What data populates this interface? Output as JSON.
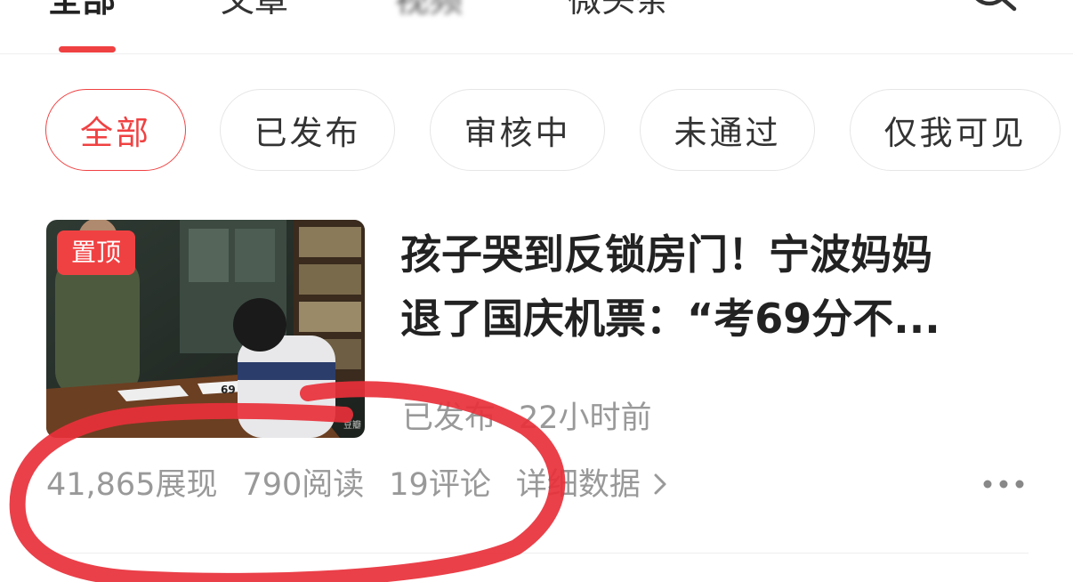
{
  "top_tabs": [
    {
      "label": "全部",
      "active": true
    },
    {
      "label": "文章",
      "active": false
    },
    {
      "label": "视频",
      "active": false
    },
    {
      "label": "微头条",
      "active": false
    }
  ],
  "filters": [
    {
      "label": "全部",
      "active": true
    },
    {
      "label": "已发布",
      "active": false
    },
    {
      "label": "审核中",
      "active": false
    },
    {
      "label": "未通过",
      "active": false
    },
    {
      "label": "仅我可见",
      "active": false
    }
  ],
  "article": {
    "badge": "置顶",
    "thumb_watermark": "豆瓣",
    "title_line1": "孩子哭到反锁房门！宁波妈妈",
    "title_line2": "退了国庆机票：“考69分不...",
    "status": "已发布",
    "time": "22小时前",
    "stats": {
      "impressions": "41,865展现",
      "reads": "790阅读",
      "comments": "19评论",
      "details_link": "详细数据"
    }
  },
  "icons": {
    "search": "search-icon",
    "chevron": "chevron-right-icon",
    "more": "more-icon"
  },
  "colors": {
    "accent": "#f04142",
    "text": "#222222",
    "muted": "#999999",
    "annotation": "#e8303a"
  }
}
